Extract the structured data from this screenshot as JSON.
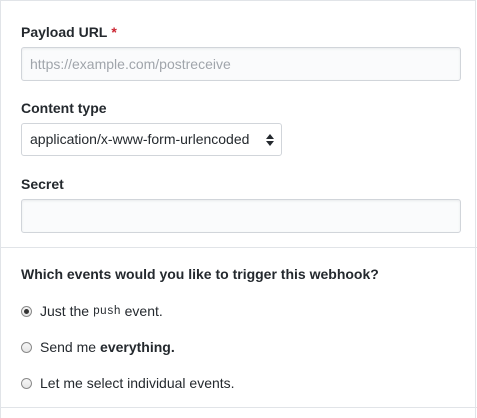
{
  "payload": {
    "label": "Payload URL",
    "required_marker": "*",
    "placeholder": "https://example.com/postreceive",
    "value": ""
  },
  "content_type": {
    "label": "Content type",
    "selected": "application/x-www-form-urlencoded"
  },
  "secret": {
    "label": "Secret",
    "value": ""
  },
  "events": {
    "heading": "Which events would you like to trigger this webhook?",
    "options": [
      {
        "prefix": "Just the",
        "code": "push",
        "suffix": "event.",
        "checked": true
      },
      {
        "prefix": "Send me",
        "bold": "everything.",
        "checked": false
      },
      {
        "label": "Let me select individual events.",
        "checked": false
      }
    ]
  },
  "colors": {
    "required": "#cb2431",
    "border": "#d1d5da",
    "divider": "#e1e4e8"
  }
}
